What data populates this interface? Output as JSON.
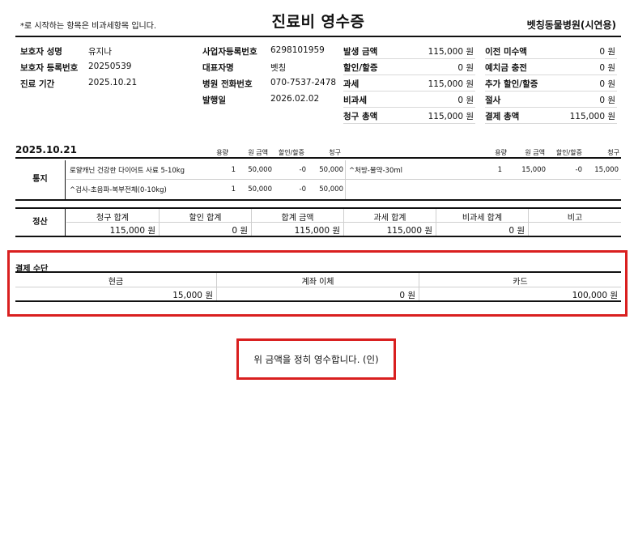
{
  "header": {
    "note": "*로 시작하는 항목은 비과세항목 입니다.",
    "title": "진료비 영수증",
    "hospital": "벳칭동물병원(시연용)"
  },
  "guardian": {
    "name_label": "보호자 성명",
    "name": "유지나",
    "reg_label": "보호자 등록번호",
    "reg": "20250539",
    "period_label": "진료 기간",
    "period": "2025.10.21"
  },
  "business": {
    "bizno_label": "사업자등록번호",
    "bizno": "6298101959",
    "rep_label": "대표자명",
    "rep": "벳칭",
    "phone_label": "병원 전화번호",
    "phone": "070-7537-2478",
    "issue_label": "발행일",
    "issue": "2026.02.02"
  },
  "amounts": [
    {
      "label": "발생 금액",
      "value": "115,000 원"
    },
    {
      "label": "할인/할증",
      "value": "0 원"
    },
    {
      "label": "과세",
      "value": "115,000 원"
    },
    {
      "label": "비과세",
      "value": "0 원"
    },
    {
      "label": "청구 총액",
      "value": "115,000 원"
    }
  ],
  "balances": [
    {
      "label": "이전 미수액",
      "value": "0 원"
    },
    {
      "label": "예치금 충전",
      "value": "0 원"
    },
    {
      "label": "추가 할인/할증",
      "value": "0 원"
    },
    {
      "label": "절사",
      "value": "0 원"
    },
    {
      "label": "결제 총액",
      "value": "115,000 원"
    }
  ],
  "detail": {
    "date": "2025.10.21",
    "headers": {
      "qty": "용량",
      "unit_price": "원 금액",
      "discount": "할인/할증",
      "charge": "청구"
    },
    "category": "통지",
    "left_items": [
      {
        "name": "로얄캐닌 건강한 다이어트 사료 5-10kg",
        "qty": "1",
        "price": "50,000",
        "discount": "-0",
        "charge": "50,000"
      },
      {
        "name": "^검사-초음파-복부전체(0-10kg)",
        "qty": "1",
        "price": "50,000",
        "discount": "-0",
        "charge": "50,000"
      }
    ],
    "right_items": [
      {
        "name": "^처방-물약-30ml",
        "qty": "1",
        "price": "15,000",
        "discount": "-0",
        "charge": "15,000"
      }
    ]
  },
  "settlement": {
    "category": "정산",
    "columns": [
      {
        "header": "청구 합계",
        "value": "115,000 원"
      },
      {
        "header": "할인 합계",
        "value": "0 원"
      },
      {
        "header": "합계 금액",
        "value": "115,000 원"
      },
      {
        "header": "과세 합계",
        "value": "115,000 원"
      },
      {
        "header": "비과세 합계",
        "value": "0 원"
      },
      {
        "header": "비고",
        "value": ""
      }
    ]
  },
  "payment": {
    "title": "결제 수단",
    "methods": [
      {
        "header": "현금",
        "value": "15,000 원"
      },
      {
        "header": "계좌 이체",
        "value": "0 원"
      },
      {
        "header": "카드",
        "value": "100,000 원"
      }
    ]
  },
  "receipt_statement": "위 금액을 정히 영수합니다. (인)",
  "colors": {
    "highlight": "#d91f1f",
    "text": "#111111",
    "rule": "#cfcfcf"
  }
}
